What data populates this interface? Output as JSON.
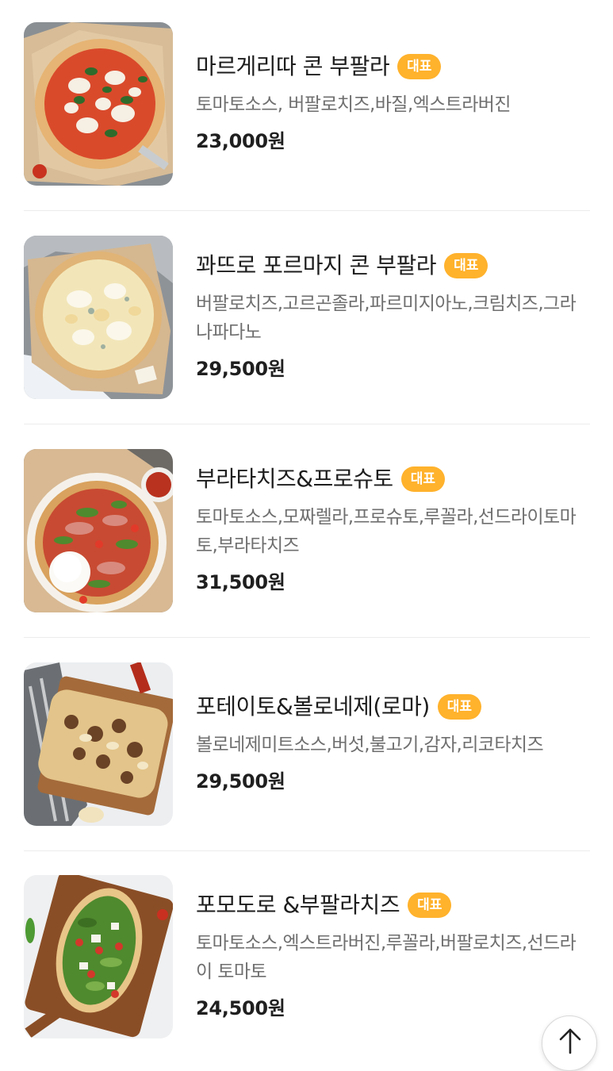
{
  "menu": {
    "items": [
      {
        "name": "마르게리따 콘 부팔라",
        "badge": "대표",
        "description": "토마토소스, 버팔로치즈,바질,엑스트라버진",
        "price": "23,000원",
        "image": "margherita-pizza"
      },
      {
        "name": "꽈뜨로 포르마지 콘 부팔라",
        "badge": "대표",
        "description": "버팔로치즈,고르곤졸라,파르미지아노,크림치즈,그라나파다노",
        "price": "29,500원",
        "image": "quattro-formaggi-pizza"
      },
      {
        "name": "부라타치즈&프로슈토",
        "badge": "대표",
        "description": "토마토소스,모짜렐라,프로슈토,루꼴라,선드라이토마토,부라타치즈",
        "price": "31,500원",
        "image": "burrata-prosciutto-pizza"
      },
      {
        "name": "포테이토&볼로네제(로마)",
        "badge": "대표",
        "description": "볼로네제미트소스,버섯,불고기,감자,리코타치즈",
        "price": "29,500원",
        "image": "potato-bolognese-pizza"
      },
      {
        "name": "포모도로 &부팔라치즈",
        "badge": "대표",
        "description": "토마토소스,엑스트라버진,루꼴라,버팔로치즈,선드라이 토마토",
        "price": "24,500원",
        "image": "pomodoro-bufala-pizza"
      }
    ]
  },
  "scroll_top": {
    "icon": "arrow-up-icon"
  },
  "colors": {
    "badge": "#ffb22c",
    "title": "#1d1d1d",
    "description": "#6f6f6f",
    "divider": "#ececec"
  }
}
